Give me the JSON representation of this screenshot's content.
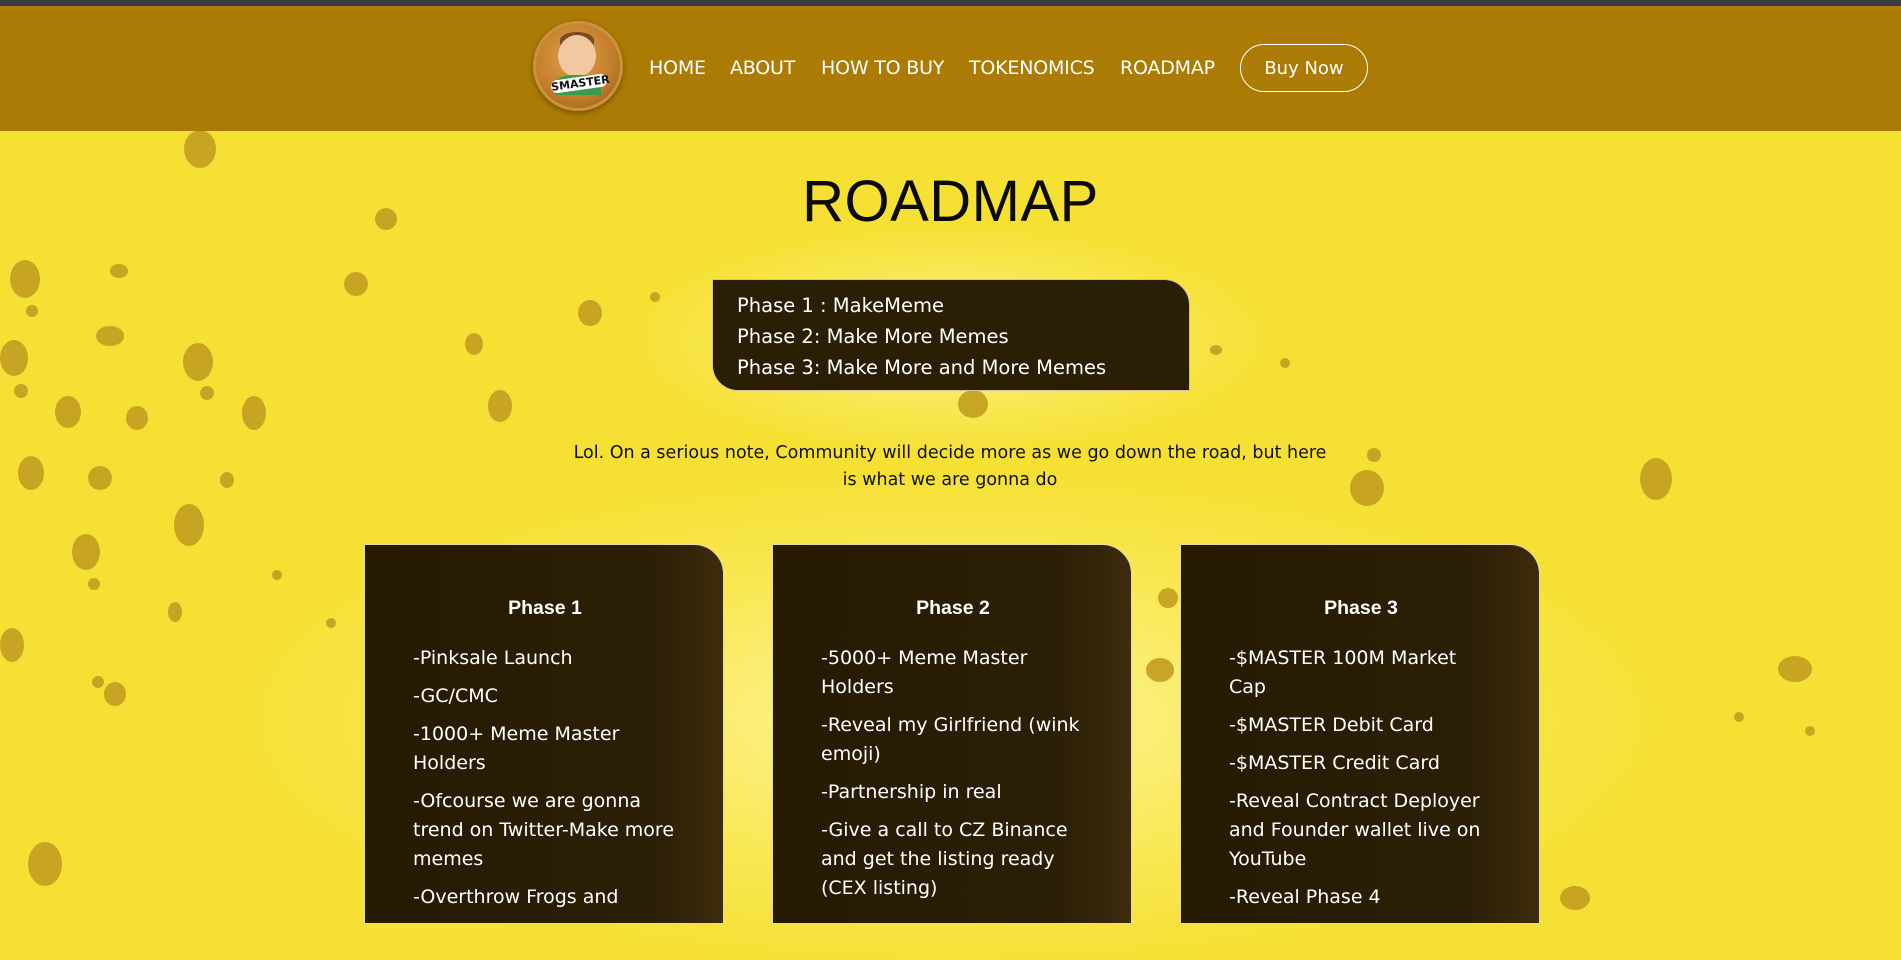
{
  "nav": {
    "logo_text": "SMASTER",
    "links": [
      "HOME",
      "ABOUT",
      "HOW TO BUY",
      "TOKENOMICS",
      "ROADMAP"
    ],
    "buy_label": "Buy Now"
  },
  "roadmap": {
    "title": "ROADMAP",
    "summary": [
      "Phase 1 : MakeMeme",
      "Phase 2: Make More Memes",
      "Phase 3: Make More and More Memes"
    ],
    "note": "Lol. On a serious note, Community will decide more as we go down the road, but here is what we are gonna do",
    "phases": [
      {
        "title": "Phase 1",
        "items": [
          "-Pinksale Launch",
          "-GC/CMC",
          "-1000+ Meme Master Holders",
          "-Ofcourse we are gonna trend on Twitter-Make more memes",
          "-Overthrow Frogs and"
        ]
      },
      {
        "title": "Phase 2",
        "items": [
          "-5000+ Meme Master Holders",
          "-Reveal my Girlfriend (wink emoji)",
          "-Partnership in real",
          "-Give a call to CZ Binance and get the listing ready (CEX listing)"
        ]
      },
      {
        "title": "Phase 3",
        "items": [
          "-$MASTER 100M Market Cap",
          "-$MASTER Debit Card",
          "-$MASTER Credit Card",
          "-Reveal Contract Deployer and Founder wallet live on YouTube",
          "-Reveal Phase 4"
        ]
      }
    ]
  }
}
